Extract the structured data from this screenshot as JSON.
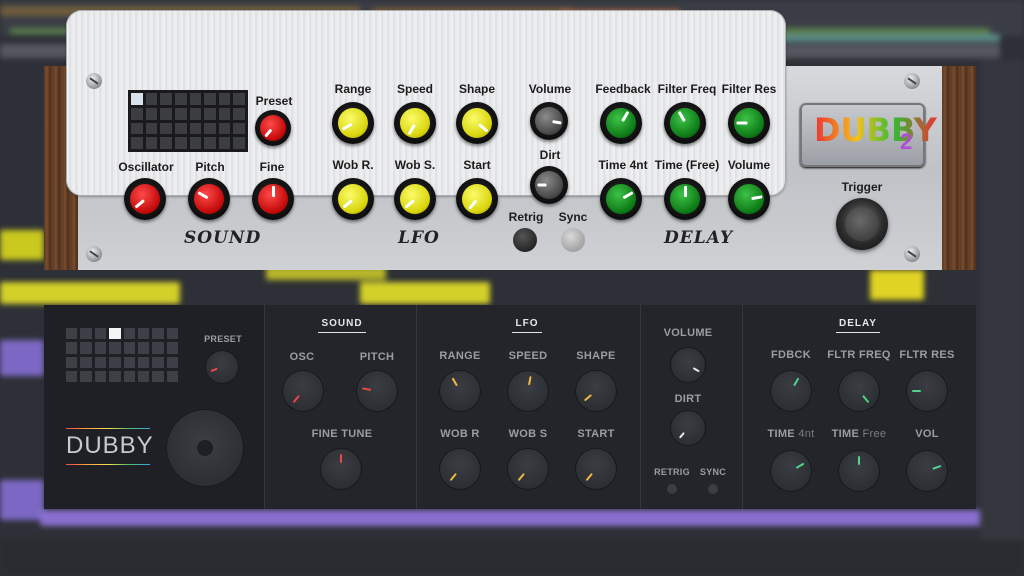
{
  "top_plugin": {
    "logo_text": "DUBBY",
    "logo_number": "2",
    "trigger_label": "Trigger",
    "preset_label": "Preset",
    "sections": {
      "sound": "SOUND",
      "lfo": "LFO",
      "delay": "DELAY"
    },
    "labels": {
      "oscillator": "Oscillator",
      "pitch": "Pitch",
      "fine": "Fine",
      "range": "Range",
      "speed": "Speed",
      "shape": "Shape",
      "wob_r": "Wob R.",
      "wob_s": "Wob S.",
      "start": "Start",
      "volume": "Volume",
      "dirt": "Dirt",
      "retrig": "Retrig",
      "sync": "Sync",
      "feedback": "Feedback",
      "filter_freq": "Filter Freq",
      "filter_res": "Filter Res",
      "time_4nt": "Time 4nt",
      "time_free": "Time (Free)",
      "delay_volume": "Volume"
    },
    "colors": {
      "sound_knob": "#d41414",
      "lfo_knob": "#e0dc12",
      "mix_knob": "#4a4a4a",
      "delay_knob": "#138a1f"
    }
  },
  "bottom_plugin": {
    "logo_text": "DUBBY",
    "preset_label": "PRESET",
    "sections": {
      "sound": "SOUND",
      "lfo": "LFO",
      "delay": "DELAY"
    },
    "labels": {
      "osc": "OSC",
      "pitch": "PITCH",
      "fine_tune": "FINE TUNE",
      "range": "RANGE",
      "speed": "SPEED",
      "shape": "SHAPE",
      "wob_r": "WOB R",
      "wob_s": "WOB S",
      "start": "START",
      "volume": "VOLUME",
      "dirt": "DIRT",
      "retrig": "RETRIG",
      "sync": "SYNC",
      "fdbck": "FDBCK",
      "fltr_freq": "FLTR FREQ",
      "fltr_res": "FLTR RES",
      "time": "TIME",
      "time_4nt_suffix": "4nt",
      "time_free_suffix": "Free",
      "vol": "VOL"
    },
    "colors": {
      "sound_mark": "#f24545",
      "lfo_mark": "#f5b642",
      "mix_mark": "#e8e8e8",
      "delay_mark": "#4fd48a"
    }
  }
}
